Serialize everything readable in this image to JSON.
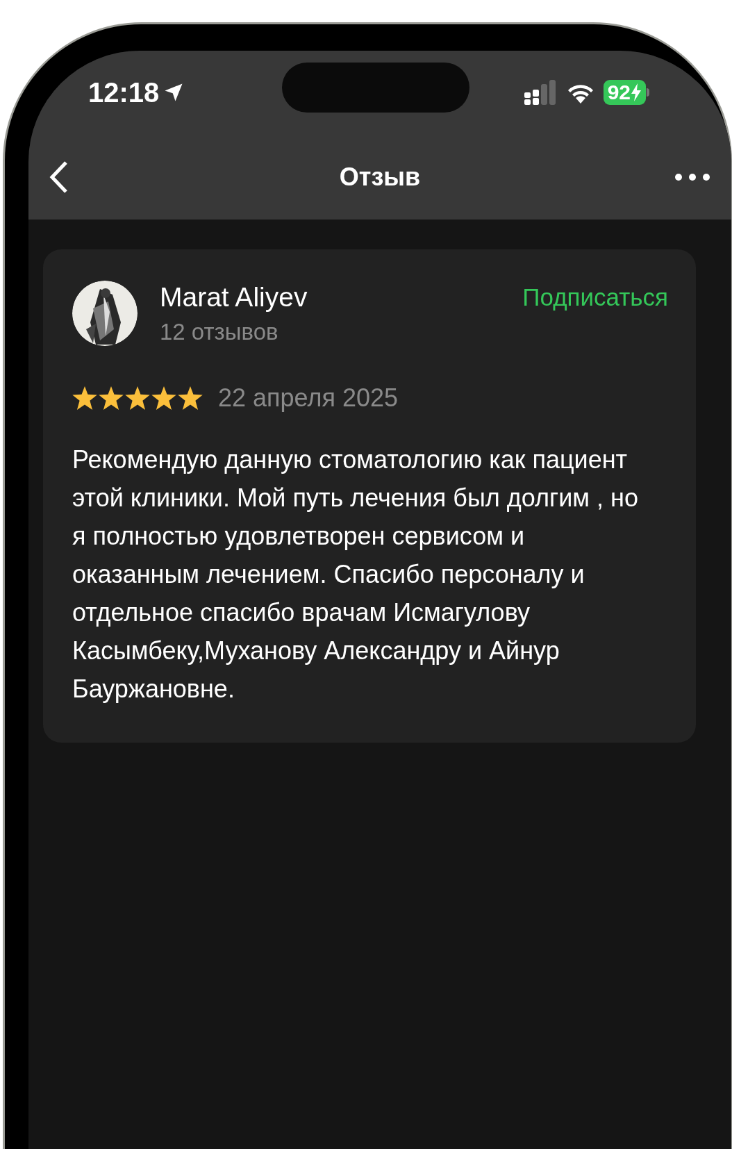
{
  "status_bar": {
    "time": "12:18",
    "battery": "92"
  },
  "nav": {
    "title": "Отзыв"
  },
  "review": {
    "author": "Marat Aliyev",
    "review_count": "12 отзывов",
    "subscribe": "Подписаться",
    "stars": 5,
    "date": "22 апреля 2025",
    "text": "Рекомендую данную стоматологию как пациент этой клиники. Мой путь лечения был долгим , но я полностью удовлетворен сервисом и оказанным лечением. Спасибо персоналу и отдельное спасибо врачам Исмагулову Касымбеку,Муханову Александру и Айнур Бауржановне."
  }
}
